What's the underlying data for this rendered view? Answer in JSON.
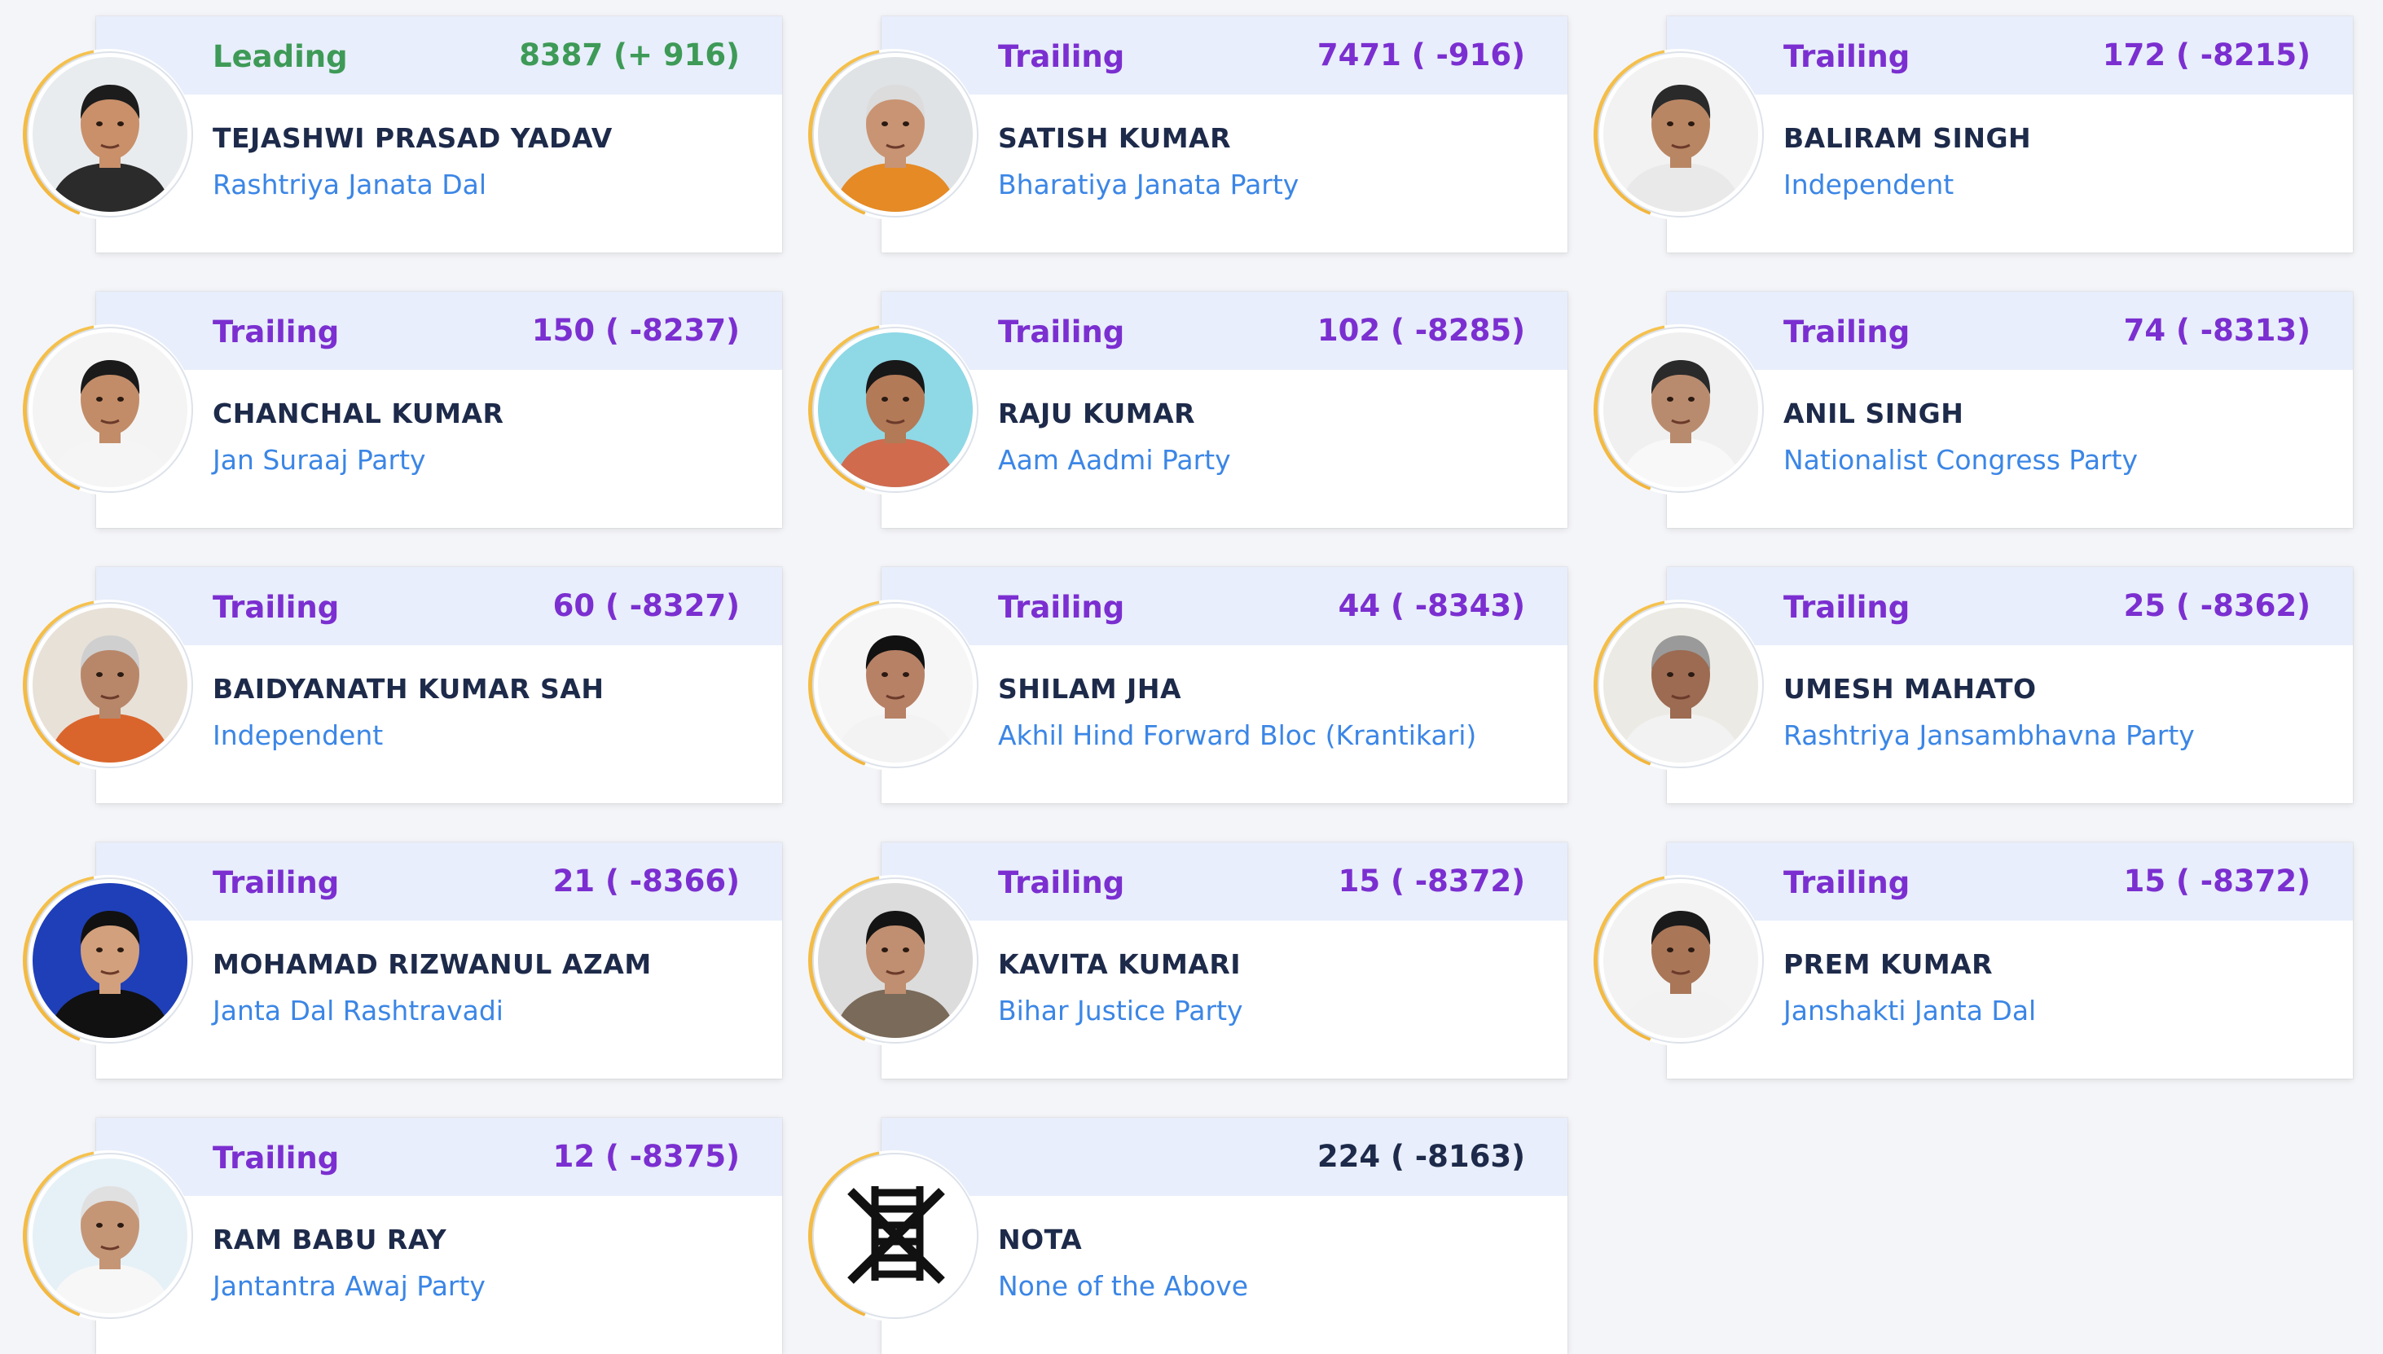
{
  "colors": {
    "leading": "#3e9a57",
    "trailing": "#7b2fd0",
    "neutral": "#1d2a4a",
    "party": "#3b86e6",
    "ring": "#f2b63d",
    "header_bg": "#e8eefb"
  },
  "candidates": [
    {
      "status": "Leading",
      "votes": "8387 (+ 916)",
      "name": "TEJASHWI PRASAD YADAV",
      "party": "Rashtriya Janata Dal",
      "photo": "candidate-photo"
    },
    {
      "status": "Trailing",
      "votes": "7471 ( -916)",
      "name": "SATISH KUMAR",
      "party": "Bharatiya Janata Party",
      "photo": "candidate-photo"
    },
    {
      "status": "Trailing",
      "votes": "172 ( -8215)",
      "name": "BALIRAM SINGH",
      "party": "Independent",
      "photo": "candidate-photo"
    },
    {
      "status": "Trailing",
      "votes": "150 ( -8237)",
      "name": "CHANCHAL KUMAR",
      "party": "Jan Suraaj Party",
      "photo": "candidate-photo"
    },
    {
      "status": "Trailing",
      "votes": "102 ( -8285)",
      "name": "RAJU KUMAR",
      "party": "Aam Aadmi Party",
      "photo": "candidate-photo"
    },
    {
      "status": "Trailing",
      "votes": "74 ( -8313)",
      "name": "ANIL SINGH",
      "party": "Nationalist Congress Party",
      "photo": "candidate-photo"
    },
    {
      "status": "Trailing",
      "votes": "60 ( -8327)",
      "name": "BAIDYANATH KUMAR SAH",
      "party": "Independent",
      "photo": "candidate-photo"
    },
    {
      "status": "Trailing",
      "votes": "44 ( -8343)",
      "name": "SHILAM JHA",
      "party": "Akhil Hind Forward Bloc (Krantikari)",
      "photo": "candidate-photo"
    },
    {
      "status": "Trailing",
      "votes": "25 ( -8362)",
      "name": "UMESH MAHATO",
      "party": "Rashtriya Jansambhavna Party",
      "photo": "candidate-photo"
    },
    {
      "status": "Trailing",
      "votes": "21 ( -8366)",
      "name": "MOHAMAD RIZWANUL AZAM",
      "party": "Janta Dal Rashtravadi",
      "photo": "candidate-photo"
    },
    {
      "status": "Trailing",
      "votes": "15 ( -8372)",
      "name": "KAVITA KUMARI",
      "party": "Bihar Justice Party",
      "photo": "candidate-photo"
    },
    {
      "status": "Trailing",
      "votes": "15 ( -8372)",
      "name": "PREM KUMAR",
      "party": "Janshakti Janta Dal",
      "photo": "candidate-photo"
    },
    {
      "status": "Trailing",
      "votes": "12 ( -8375)",
      "name": "RAM BABU RAY",
      "party": "Jantantra Awaj Party",
      "photo": "candidate-photo"
    },
    {
      "status": "",
      "votes": "224 ( -8163)",
      "name": "NOTA",
      "party": "None of the Above",
      "photo": "nota-ballot-icon"
    }
  ]
}
